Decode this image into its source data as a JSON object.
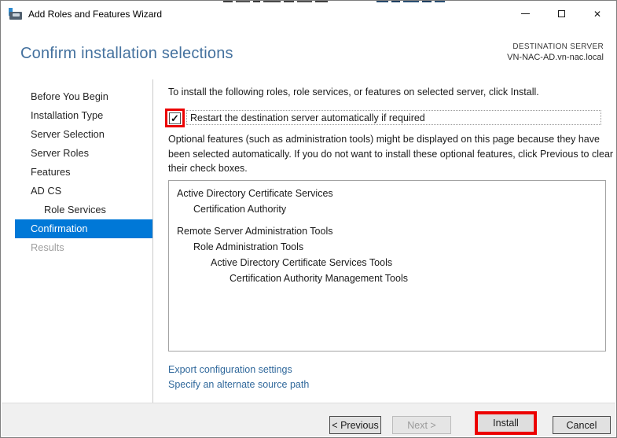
{
  "window": {
    "title": "Add Roles and Features Wizard"
  },
  "header": {
    "page_title": "Confirm installation selections",
    "destination_label": "DESTINATION SERVER",
    "destination_value": "VN-NAC-AD.vn-nac.local"
  },
  "sidebar": {
    "items": [
      {
        "label": "Before You Begin",
        "state": "normal"
      },
      {
        "label": "Installation Type",
        "state": "normal"
      },
      {
        "label": "Server Selection",
        "state": "normal"
      },
      {
        "label": "Server Roles",
        "state": "normal"
      },
      {
        "label": "Features",
        "state": "normal"
      },
      {
        "label": "AD CS",
        "state": "normal"
      },
      {
        "label": "Role Services",
        "state": "sub"
      },
      {
        "label": "Confirmation",
        "state": "selected"
      },
      {
        "label": "Results",
        "state": "disabled"
      }
    ]
  },
  "content": {
    "intro": "To install the following roles, role services, or features on selected server, click Install.",
    "restart_checkbox": {
      "checked": true,
      "label": "Restart the destination server automatically if required"
    },
    "optional_note_lines": [
      "Optional features (such as administration tools) might be displayed on this page because they have",
      "been selected automatically. If you do not want to install these optional features, click Previous to clear",
      "their check boxes."
    ],
    "selected_items": [
      {
        "label": "Active Directory Certificate Services",
        "indent": 0
      },
      {
        "label": "Certification Authority",
        "indent": 1
      },
      {
        "label": "Remote Server Administration Tools",
        "indent": 0
      },
      {
        "label": "Role Administration Tools",
        "indent": 1
      },
      {
        "label": "Active Directory Certificate Services Tools",
        "indent": 2
      },
      {
        "label": "Certification Authority Management Tools",
        "indent": 3
      }
    ],
    "links": {
      "export_config": "Export configuration settings",
      "alt_source": "Specify an alternate source path"
    }
  },
  "footer": {
    "previous": "< Previous",
    "next": "Next >",
    "install": "Install",
    "cancel": "Cancel"
  },
  "colors": {
    "nav_selected": "#0078d7",
    "annotation_red": "#ec0000",
    "page_title": "#44719e",
    "link": "#31699c"
  }
}
